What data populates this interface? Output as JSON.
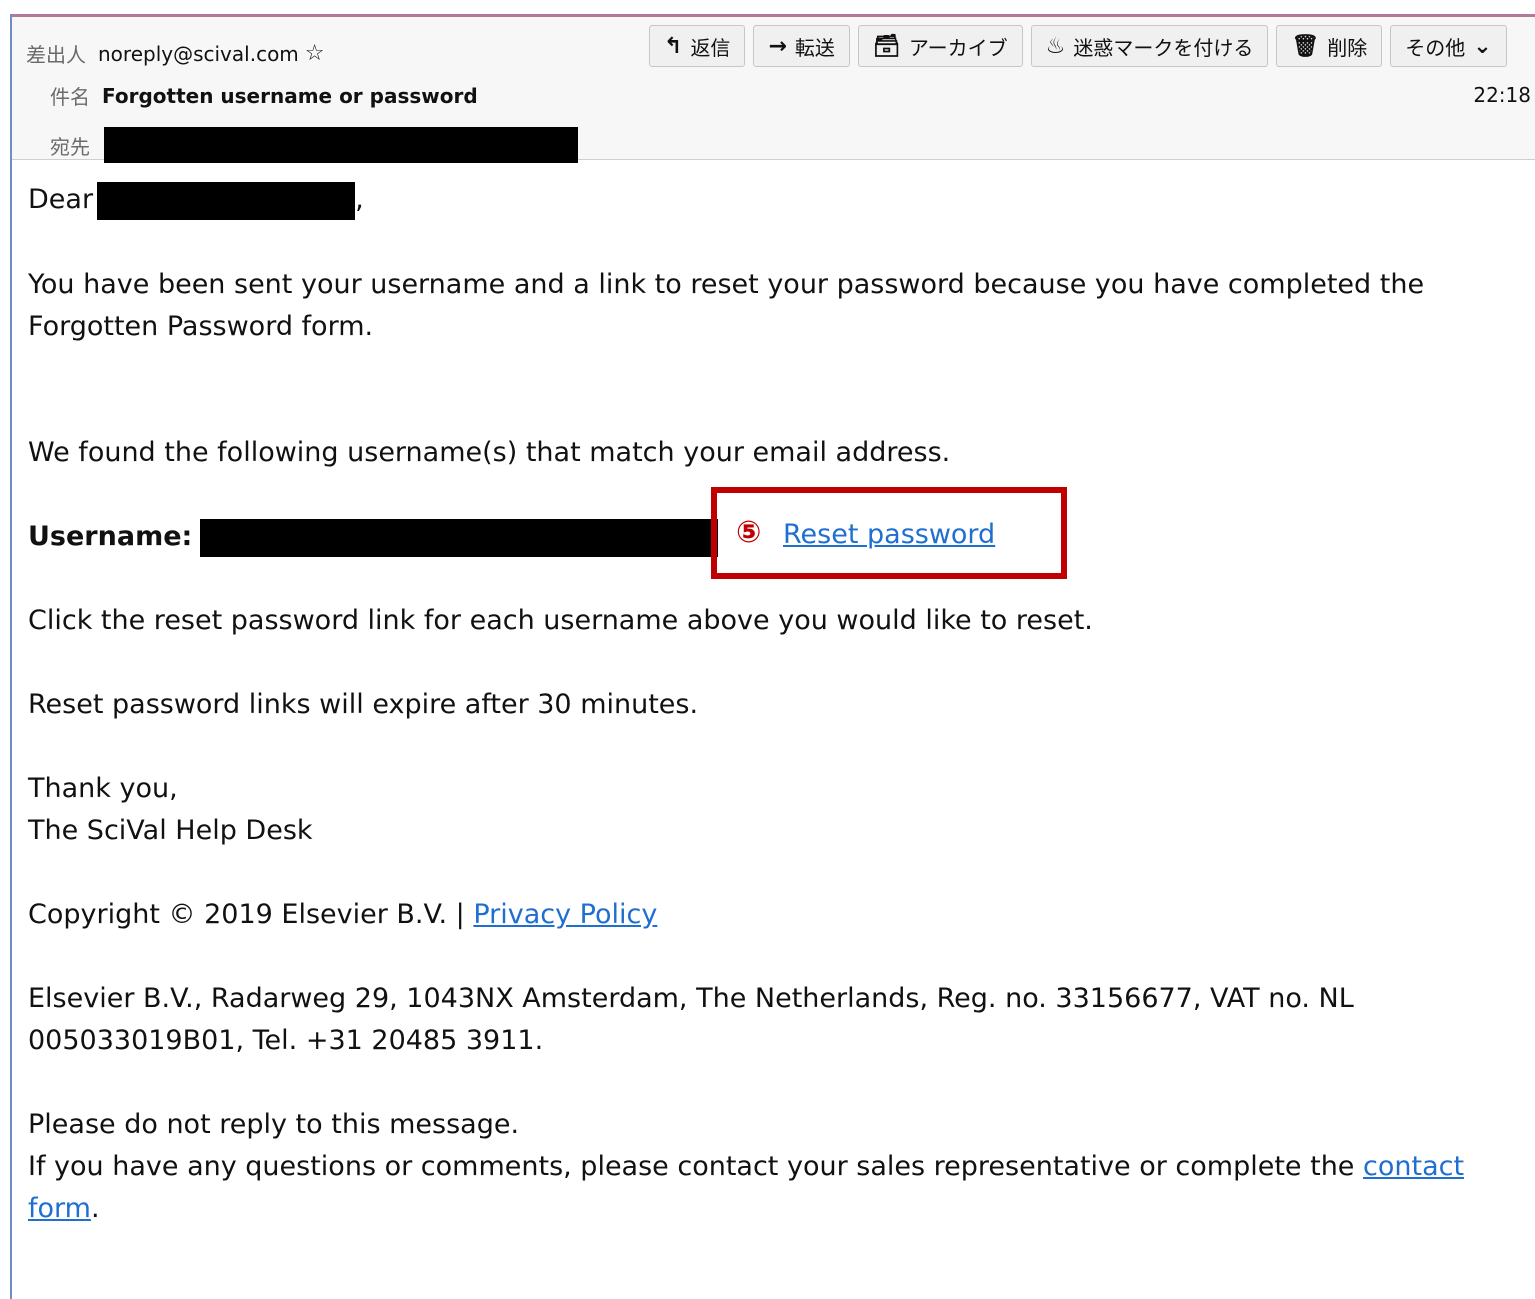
{
  "header": {
    "from_label": "差出人",
    "from_address": "noreply@scival.com",
    "subject_label": "件名",
    "subject": "Forgotten username or password",
    "to_label": "宛先",
    "time": "22:18"
  },
  "toolbar": {
    "reply": "返信",
    "forward": "転送",
    "archive": "アーカイブ",
    "junk": "迷惑マークを付ける",
    "delete": "削除",
    "more": "その他"
  },
  "body": {
    "greeting": "Dear",
    "greeting_suffix": ",",
    "para1_line1": "You have been sent your username and a link to reset your password because you have completed the",
    "para1_line2": "Forgotten Password form.",
    "para2": "We found the following username(s) that match your email address.",
    "username_label": "Username:",
    "step_marker": "⑤",
    "reset_link": "Reset password",
    "para3": "Click the reset password link for each username above you would like to reset.",
    "para4": "Reset password links will expire after 30 minutes.",
    "thanks": "Thank you,",
    "signature": "The SciVal Help Desk",
    "copyright": "Copyright © 2019 Elsevier B.V. | ",
    "privacy_link": "Privacy Policy",
    "address_line1": "Elsevier B.V., Radarweg 29, 1043NX Amsterdam, The Netherlands, Reg. no. 33156677, VAT no. NL",
    "address_line2": "005033019B01, Tel. +31 20485 3911.",
    "noreply": "Please do not reply to this message.",
    "contact_line": "If you have any questions or comments, please contact your sales representative or complete the ",
    "contact_link_part1": "contact",
    "contact_link_part2": "form",
    "contact_end": "."
  }
}
